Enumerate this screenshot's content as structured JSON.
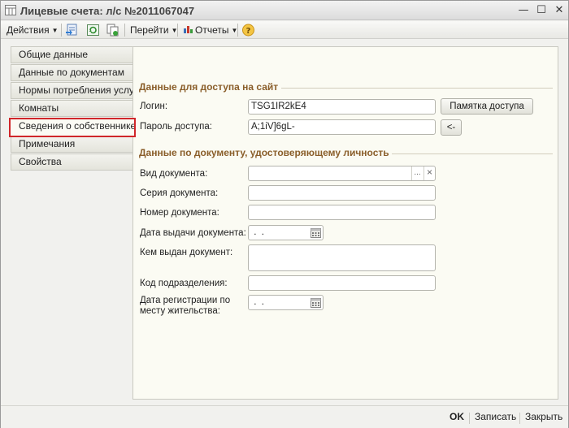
{
  "window": {
    "title": "Лицевые счета: л/с №2011067047",
    "icons": {
      "app": "table-icon",
      "minimize": "minimize-icon",
      "maximize": "maximize-icon",
      "close": "close-icon"
    }
  },
  "toolbar": {
    "actions_label": "Действия",
    "goto_label": "Перейти",
    "reports_label": "Отчеты",
    "icons": [
      "save-back-icon",
      "refresh-icon",
      "copy-icon",
      "help-icon"
    ]
  },
  "tabs": [
    {
      "label": "Общие данные"
    },
    {
      "label": "Данные по документам"
    },
    {
      "label": "Нормы потребления услуг"
    },
    {
      "label": "Комнаты"
    },
    {
      "label": "Сведения о собственнике"
    },
    {
      "label": "Примечания"
    },
    {
      "label": "Свойства"
    }
  ],
  "active_tab": "Сведения о собственнике",
  "access": {
    "section_title": "Данные для доступа на сайт",
    "login_label": "Логин:",
    "login_value": "TSG1IR2kE4",
    "memo_button": "Памятка доступа",
    "password_label": "Пароль доступа:",
    "password_value": "A;1iV]6gL-",
    "arrow_button": "<-"
  },
  "document": {
    "section_title": "Данные по документу, удостоверяющему личность",
    "doc_type_label": "Вид документа:",
    "doc_type_value": "",
    "ellipsis": "...",
    "clear": "×",
    "series_label": "Серия документа:",
    "series_value": "",
    "number_label": "Номер документа:",
    "number_value": "",
    "issue_date_label": "Дата выдачи документа:",
    "issue_date_value": " .  .",
    "issued_by_label": "Кем выдан документ:",
    "issued_by_value": "",
    "dept_code_label": "Код подразделения:",
    "dept_code_value": "",
    "reg_date_label": "Дата регистрации по месту жительства:",
    "reg_date_value": " .  ."
  },
  "footer": {
    "ok": "OK",
    "save": "Записать",
    "close": "Закрыть"
  },
  "colors": {
    "section_title": "#8a5e2a",
    "active_tab_border": "#d0262a",
    "panel_bg": "#fbfbf3"
  }
}
